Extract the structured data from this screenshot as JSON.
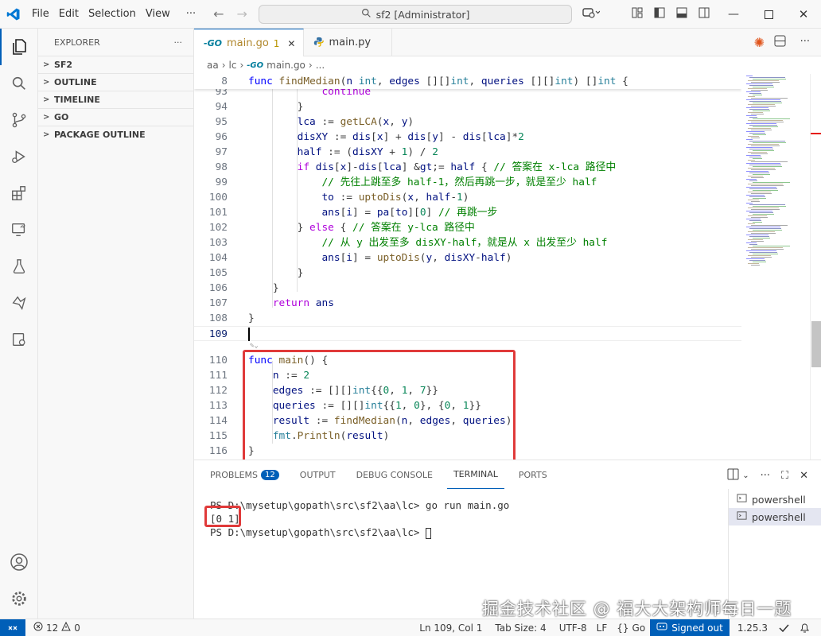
{
  "titlebar": {
    "menus": [
      "File",
      "Edit",
      "Selection",
      "View",
      "···"
    ],
    "search_text": "sf2 [Administrator]"
  },
  "sidebar": {
    "header": "EXPLORER",
    "more": "···",
    "sections": [
      "SF2",
      "OUTLINE",
      "TIMELINE",
      "GO",
      "PACKAGE OUTLINE"
    ]
  },
  "tabs": [
    {
      "label": "main.go",
      "problems": "1",
      "close": "✕"
    },
    {
      "label": "main.py"
    }
  ],
  "breadcrumb": [
    "aa",
    "lc",
    "main.go",
    "..."
  ],
  "editor": {
    "sticky": {
      "ln": "8",
      "text": "func findMedian(n int, edges [][]int, queries [][]int) []int {"
    },
    "current_line": "109",
    "lines": [
      {
        "ln": "93",
        "text": "            continue"
      },
      {
        "ln": "94",
        "text": "        }"
      },
      {
        "ln": "95",
        "text": "        lca := getLCA(x, y)"
      },
      {
        "ln": "96",
        "text": "        disXY := dis[x] + dis[y] - dis[lca]*2"
      },
      {
        "ln": "97",
        "text": "        half := (disXY + 1) / 2"
      },
      {
        "ln": "98",
        "text": "        if dis[x]-dis[lca] >= half { // 答案在 x-lca 路径中"
      },
      {
        "ln": "99",
        "text": "            // 先往上跳至多 half-1，然后再跳一步，就是至少 half"
      },
      {
        "ln": "100",
        "text": "            to := uptoDis(x, half-1)"
      },
      {
        "ln": "101",
        "text": "            ans[i] = pa[to][0] // 再跳一步"
      },
      {
        "ln": "102",
        "text": "        } else { // 答案在 y-lca 路径中"
      },
      {
        "ln": "103",
        "text": "            // 从 y 出发至多 disXY-half，就是从 x 出发至少 half"
      },
      {
        "ln": "104",
        "text": "            ans[i] = uptoDis(y, disXY-half)"
      },
      {
        "ln": "105",
        "text": "        }"
      },
      {
        "ln": "106",
        "text": "    }"
      },
      {
        "ln": "107",
        "text": "    return ans"
      },
      {
        "ln": "108",
        "text": "}"
      },
      {
        "ln": "109",
        "text": ""
      },
      {
        "ln": "110",
        "text": "func main() {"
      },
      {
        "ln": "111",
        "text": "    n := 2"
      },
      {
        "ln": "112",
        "text": "    edges := [][]int{{0, 1, 7}}"
      },
      {
        "ln": "113",
        "text": "    queries := [][]int{{1, 0}, {0, 1}}"
      },
      {
        "ln": "114",
        "text": "    result := findMedian(n, edges, queries)"
      },
      {
        "ln": "115",
        "text": "    fmt.Println(result)"
      },
      {
        "ln": "116",
        "text": "}"
      }
    ]
  },
  "panel": {
    "tabs": [
      "PROBLEMS",
      "OUTPUT",
      "DEBUG CONSOLE",
      "TERMINAL",
      "PORTS"
    ],
    "problems_count": "12",
    "terminal_lines": [
      "PS D:\\mysetup\\gopath\\src\\sf2\\aa\\lc> go run main.go",
      "[0 1]",
      "PS D:\\mysetup\\gopath\\src\\sf2\\aa\\lc> "
    ],
    "terminals": [
      "powershell",
      "powershell"
    ]
  },
  "status": {
    "errors": "12",
    "warnings": "0",
    "position": "Ln 109, Col 1",
    "tab_size": "Tab Size: 4",
    "encoding": "UTF-8",
    "eol": "LF",
    "language": "Go",
    "account": "Signed out",
    "version": "1.25.3"
  },
  "watermark": "掘金技术社区 @ 福大大架构师每日一题",
  "colors": {
    "accent": "#005fb8",
    "highlight_box": "#e03a3a"
  }
}
